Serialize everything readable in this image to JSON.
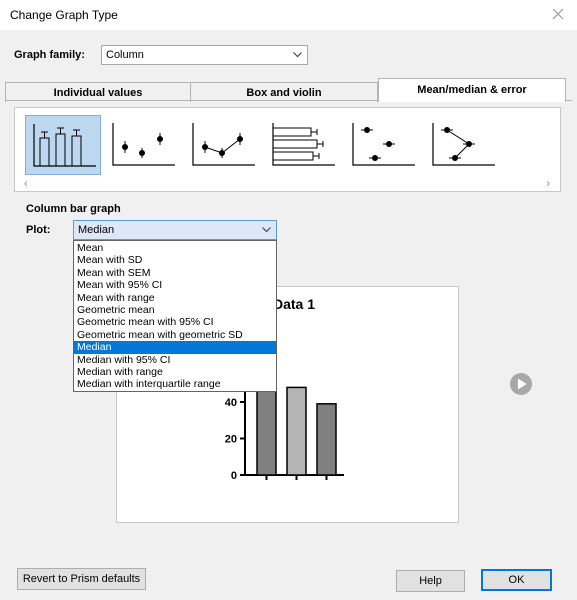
{
  "window": {
    "title": "Change Graph Type"
  },
  "family": {
    "label": "Graph family:",
    "value": "Column"
  },
  "tabs": [
    {
      "label": "Individual values"
    },
    {
      "label": "Box and violin"
    },
    {
      "label": "Mean/median & error"
    }
  ],
  "gallery": {
    "thumbs": [
      "column-bar-graph",
      "column-mean-points",
      "column-mean-connected",
      "horizontal-bars",
      "horizontal-points",
      "horizontal-connected"
    ]
  },
  "section_title": "Column bar graph",
  "plot": {
    "label": "Plot:",
    "value": "Median",
    "options": [
      "Mean",
      "Mean with SD",
      "Mean with SEM",
      "Mean with 95% CI",
      "Mean with range",
      "Geometric mean",
      "Geometric mean with 95% CI",
      "Geometric mean with geometric SD",
      "Median",
      "Median with 95% CI",
      "Median with range",
      "Median with interquartile range"
    ],
    "selected_index": 8
  },
  "preview": {
    "title": "Data 1"
  },
  "chart_data": {
    "type": "bar",
    "title": "Data 1",
    "categories": [
      "",
      "",
      ""
    ],
    "values": [
      53,
      48,
      39
    ],
    "yticks": [
      0,
      20,
      40
    ],
    "ylim": [
      0,
      60
    ],
    "bar_colors": [
      "#808080",
      "#b4b4b4",
      "#808080"
    ]
  },
  "buttons": {
    "revert": "Revert to Prism defaults",
    "help": "Help",
    "ok": "OK"
  }
}
